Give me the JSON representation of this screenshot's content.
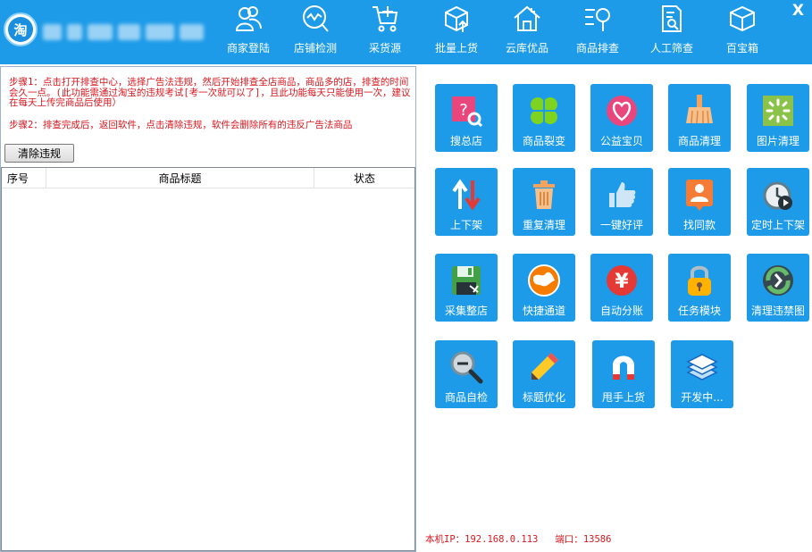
{
  "window": {
    "close_label": "X"
  },
  "nav": [
    {
      "label": "商家登陆",
      "icon": "users-icon"
    },
    {
      "label": "店铺检测",
      "icon": "search-chart-icon"
    },
    {
      "label": "采货源",
      "icon": "cart-add-icon"
    },
    {
      "label": "批量上货",
      "icon": "box-upload-icon"
    },
    {
      "label": "云库优品",
      "icon": "house-icon"
    },
    {
      "label": "商品排查",
      "icon": "list-search-icon"
    },
    {
      "label": "人工筛查",
      "icon": "document-search-icon"
    },
    {
      "label": "百宝箱",
      "icon": "cube-icon"
    }
  ],
  "steps": {
    "step1": "步骤1：点击打开排查中心，选择广告法违规，然后开始排查全店商品，商品多的店，排查的时间会久一点。(此功能需通过淘宝的违规考试[考一次就可以了]，且此功能每天只能使用一次，建议在每天上传完商品后使用）",
    "step2": "步骤2：排查完成后，返回软件，点击清除违规，软件会删除所有的违反广告法商品"
  },
  "clear_button": "清除违规",
  "table": {
    "columns": [
      "序号",
      "商品标题",
      "状态"
    ],
    "rows": []
  },
  "apps": [
    {
      "label": "搜总店",
      "icon": "shop-search-icon"
    },
    {
      "label": "商品裂变",
      "icon": "clover-icon"
    },
    {
      "label": "公益宝贝",
      "icon": "heart-icon"
    },
    {
      "label": "商品清理",
      "icon": "broom-icon"
    },
    {
      "label": "图片清理",
      "icon": "image-clean-icon"
    },
    {
      "label": "上下架",
      "icon": "up-down-arrows-icon"
    },
    {
      "label": "重复清理",
      "icon": "trash-icon"
    },
    {
      "label": "一键好评",
      "icon": "thumbs-up-icon"
    },
    {
      "label": "找同款",
      "icon": "find-same-icon"
    },
    {
      "label": "定时上下架",
      "icon": "alarm-clock-icon"
    },
    {
      "label": "采集整店",
      "icon": "floppy-disk-icon"
    },
    {
      "label": "快捷通道",
      "icon": "globe-icon"
    },
    {
      "label": "自动分账",
      "icon": "yuan-icon"
    },
    {
      "label": "任务模块",
      "icon": "padlock-icon"
    },
    {
      "label": "清理违禁图",
      "icon": "refresh-arrow-icon"
    },
    {
      "label": "商品自检",
      "icon": "magnifier-icon"
    },
    {
      "label": "标题优化",
      "icon": "pencil-icon"
    },
    {
      "label": "甩手上货",
      "icon": "magnet-icon"
    },
    {
      "label": "开发中...",
      "icon": "layers-icon"
    }
  ],
  "footer": {
    "ip_label": "本机IP：",
    "ip": "192.168.0.113",
    "port_label": "端口：",
    "port": "13586"
  },
  "colors": {
    "accent": "#1e9be8",
    "warning_text": "#d8171f"
  }
}
